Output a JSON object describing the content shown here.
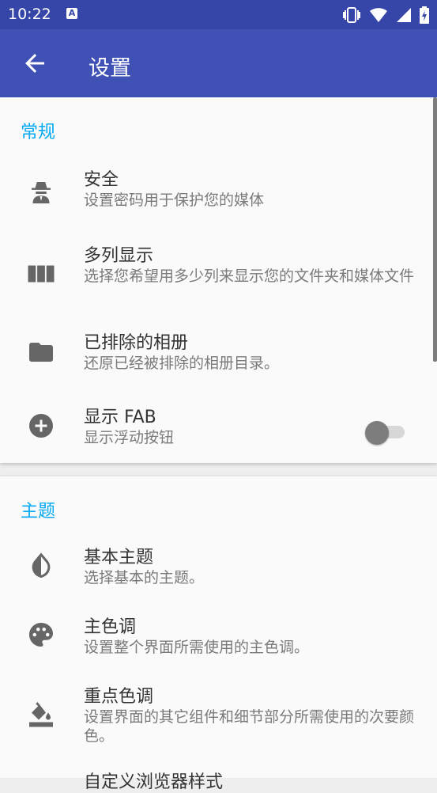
{
  "status_bar": {
    "time": "10:22",
    "notification_icon_label": "A",
    "icons": [
      "vibrate-icon",
      "wifi-icon",
      "signal-icon",
      "battery-charging-icon"
    ]
  },
  "toolbar": {
    "title": "设置",
    "back_icon": "arrow-back-icon"
  },
  "sections": {
    "general": {
      "header": "常规",
      "items": [
        {
          "title": "安全",
          "subtitle": "设置密码用于保护您的媒体",
          "icon": "spy-icon"
        },
        {
          "title": "多列显示",
          "subtitle": "选择您希望用多少列来显示您的文件夹和媒体文件",
          "icon": "columns-icon"
        },
        {
          "title": "已排除的相册",
          "subtitle": "还原已经被排除的相册目录。",
          "icon": "folder-icon"
        },
        {
          "title": "显示 FAB",
          "subtitle": "显示浮动按钮",
          "icon": "plus-circle-icon",
          "toggle": false
        }
      ]
    },
    "theme": {
      "header": "主题",
      "items": [
        {
          "title": "基本主题",
          "subtitle": "选择基本的主题。",
          "icon": "invert-colors-icon"
        },
        {
          "title": "主色调",
          "subtitle": "设置整个界面所需使用的主色调。",
          "icon": "palette-icon"
        },
        {
          "title": "重点色调",
          "subtitle": "设置界面的其它组件和细节部分所需使用的次要颜色。",
          "icon": "paint-bucket-icon"
        },
        {
          "title": "自定义浏览器样式"
        }
      ]
    }
  },
  "colors": {
    "primary": "#3f51b5",
    "primary_dark": "#3545a8",
    "accent": "#03a9f4",
    "icon_gray": "#666666"
  }
}
